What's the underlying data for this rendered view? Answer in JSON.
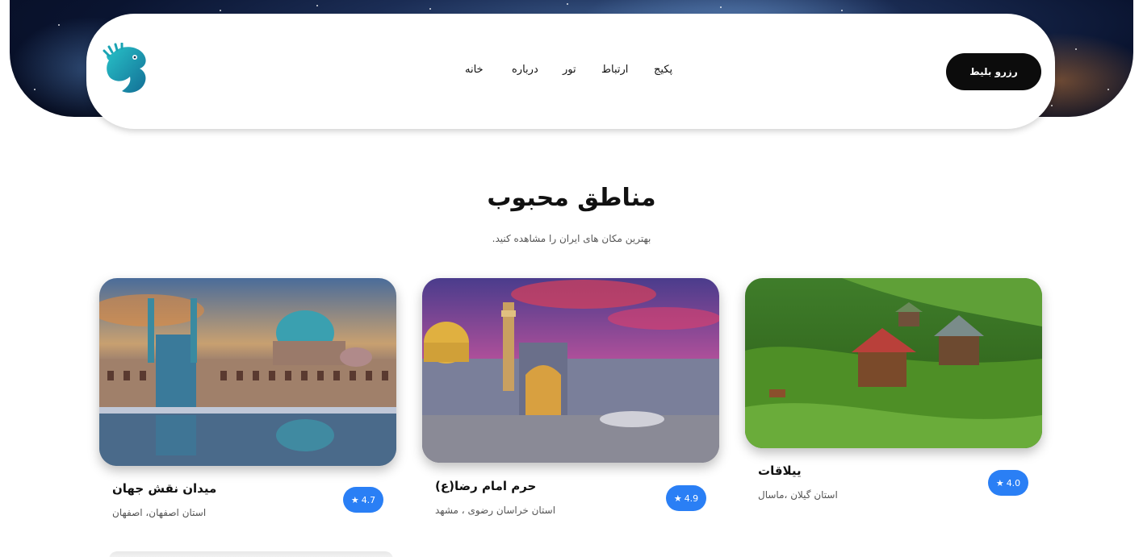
{
  "colors": {
    "accent": "#2a7ff5",
    "button_bg": "#0c0c0c",
    "logo": "#1aa3b3"
  },
  "header": {
    "logo_icon": "seahorse-logo-icon",
    "nav": [
      {
        "label": "خانه"
      },
      {
        "label": "درباره"
      },
      {
        "label": "تور"
      },
      {
        "label": "ارتباط"
      },
      {
        "label": "پکیج"
      }
    ],
    "book_button": "رزرو بلیط"
  },
  "section": {
    "title": "مناطق محبوب",
    "subtitle": "بهترین مکان های ایران را مشاهده کنید."
  },
  "places": [
    {
      "name": "ییلاقات",
      "location": "استان گیلان ،ماسال",
      "rating": "4.0",
      "star": "★"
    },
    {
      "name": "حرم امام رضا(ع)",
      "location": "استان خراسان رضوی ، مشهد",
      "rating": "4.9",
      "star": "★"
    },
    {
      "name": "میدان نقش جهان",
      "location": "استان اصفهان، اصفهان",
      "rating": "4.7",
      "star": "★"
    }
  ]
}
